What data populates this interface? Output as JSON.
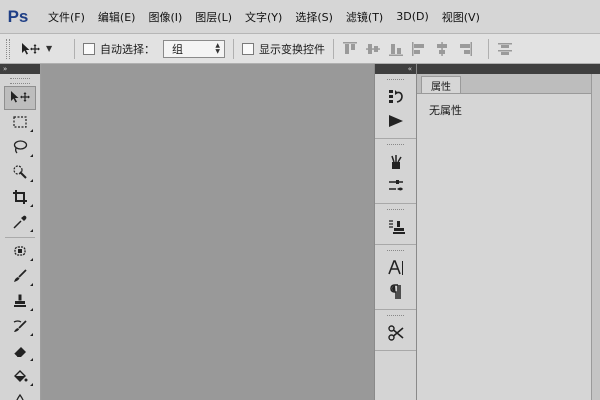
{
  "app": {
    "logo": "Ps"
  },
  "menu": [
    {
      "label": "文件(F)"
    },
    {
      "label": "编辑(E)"
    },
    {
      "label": "图像(I)"
    },
    {
      "label": "图层(L)"
    },
    {
      "label": "文字(Y)"
    },
    {
      "label": "选择(S)"
    },
    {
      "label": "滤镜(T)"
    },
    {
      "label": "3D(D)"
    },
    {
      "label": "视图(V)"
    }
  ],
  "options_bar": {
    "tool_preset_icon": "move-tool-icon",
    "auto_select_label": "自动选择：",
    "auto_select_checked": false,
    "auto_select_target": "组",
    "show_transform_label": "显示变换控件",
    "show_transform_checked": false,
    "align_icons": [
      "align-top-icon",
      "align-vertical-center-icon",
      "align-bottom-icon",
      "align-left-icon",
      "align-horizontal-center-icon",
      "align-right-icon",
      "distribute-top-icon"
    ]
  },
  "toolbox": {
    "collapse_label": "»",
    "tools": [
      {
        "name": "move-tool",
        "icon": "move-icon",
        "active": true
      },
      {
        "name": "rectangular-marquee-tool",
        "icon": "marquee-icon"
      },
      {
        "name": "lasso-tool",
        "icon": "lasso-icon"
      },
      {
        "name": "quick-selection-tool",
        "icon": "quick-selection-icon"
      },
      {
        "name": "crop-tool",
        "icon": "crop-icon"
      },
      {
        "name": "eyedropper-tool",
        "icon": "eyedropper-icon"
      },
      {
        "name": "spot-healing-brush-tool",
        "icon": "healing-brush-icon"
      },
      {
        "name": "brush-tool",
        "icon": "brush-icon"
      },
      {
        "name": "clone-stamp-tool",
        "icon": "clone-stamp-icon"
      },
      {
        "name": "history-brush-tool",
        "icon": "history-brush-icon"
      },
      {
        "name": "eraser-tool",
        "icon": "eraser-icon"
      },
      {
        "name": "paint-bucket-tool",
        "icon": "paint-bucket-icon"
      },
      {
        "name": "blur-tool",
        "icon": "blur-icon"
      }
    ]
  },
  "panel_strip": {
    "collapse_label": "«",
    "groups": [
      [
        "history-icon",
        "actions-play-icon"
      ],
      [
        "brush-presets-icon",
        "brush-settings-icon"
      ],
      [
        "clone-source-icon"
      ],
      [
        "character-icon",
        "paragraph-icon"
      ],
      [
        "tool-presets-icon"
      ]
    ]
  },
  "properties": {
    "tab_label": "属性",
    "content_text": "无属性"
  },
  "colors": {
    "menubar_bg": "#d6d6d6",
    "canvas_bg": "#999999",
    "panel_bg": "#d4d4d4",
    "logo_color": "#1f3f86"
  }
}
